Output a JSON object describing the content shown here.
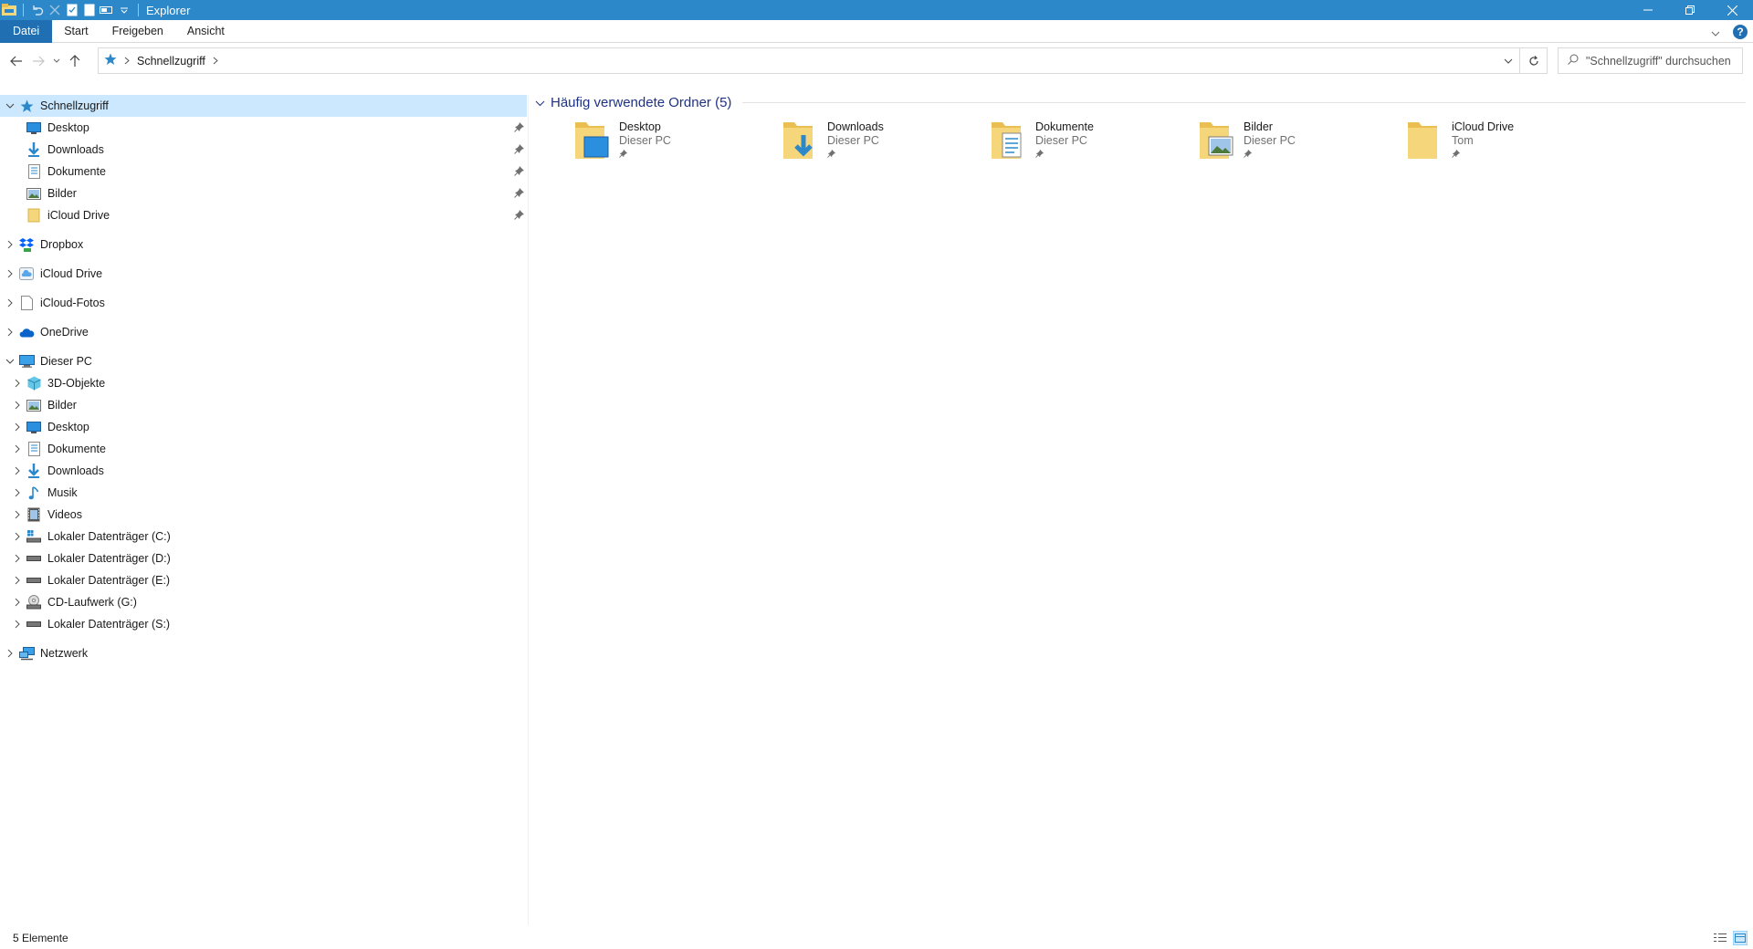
{
  "window": {
    "title": "Explorer"
  },
  "ribbon": {
    "tabs": [
      "Datei",
      "Start",
      "Freigeben",
      "Ansicht"
    ]
  },
  "address": {
    "path": [
      "Schnellzugriff"
    ]
  },
  "search": {
    "placeholder": "\"Schnellzugriff\" durchsuchen"
  },
  "nav": {
    "quick_access": {
      "label": "Schnellzugriff",
      "items": [
        "Desktop",
        "Downloads",
        "Dokumente",
        "Bilder",
        "iCloud Drive"
      ]
    },
    "roots": [
      "Dropbox",
      "iCloud Drive",
      "iCloud-Fotos",
      "OneDrive"
    ],
    "this_pc": {
      "label": "Dieser PC",
      "items": [
        "3D-Objekte",
        "Bilder",
        "Desktop",
        "Dokumente",
        "Downloads",
        "Musik",
        "Videos",
        "Lokaler Datenträger (C:)",
        "Lokaler Datenträger (D:)",
        "Lokaler Datenträger (E:)",
        "CD-Laufwerk (G:)",
        "Lokaler Datenträger (S:)"
      ]
    },
    "network": "Netzwerk"
  },
  "content": {
    "group_title": "Häufig verwendete Ordner (5)",
    "folders": [
      {
        "name": "Desktop",
        "location": "Dieser PC",
        "icon": "desktop-folder-icon"
      },
      {
        "name": "Downloads",
        "location": "Dieser PC",
        "icon": "downloads-folder-icon"
      },
      {
        "name": "Dokumente",
        "location": "Dieser PC",
        "icon": "documents-folder-icon"
      },
      {
        "name": "Bilder",
        "location": "Dieser PC",
        "icon": "pictures-folder-icon"
      },
      {
        "name": "iCloud Drive",
        "location": "Tom",
        "icon": "folder-icon"
      }
    ]
  },
  "status": {
    "count": "5 Elemente"
  },
  "colors": {
    "titlebar": "#2c88c9",
    "file_tab": "#1f6fb2",
    "selection": "#cce8ff",
    "folder": "#f5d67a",
    "group_title": "#1e3287"
  }
}
